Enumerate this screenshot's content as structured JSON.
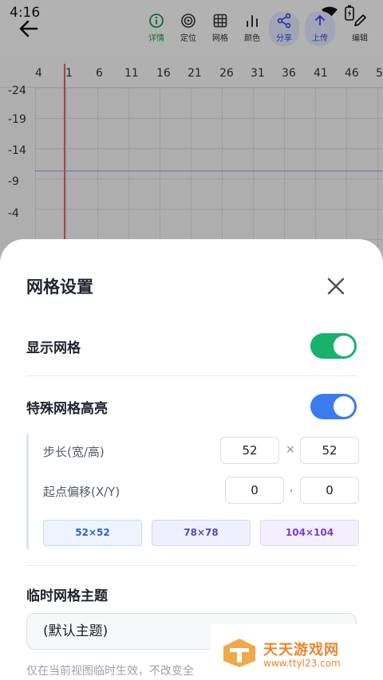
{
  "status_bar": {
    "time": "4:16"
  },
  "toolbar": {
    "items": [
      {
        "label": "详情",
        "icon": "info-icon"
      },
      {
        "label": "定位",
        "icon": "target-icon"
      },
      {
        "label": "网格",
        "icon": "grid-icon"
      },
      {
        "label": "颜色",
        "icon": "bar-chart-icon"
      },
      {
        "label": "分享",
        "icon": "share-icon"
      },
      {
        "label": "上传",
        "icon": "upload-icon"
      },
      {
        "label": "编辑",
        "icon": "pencil-icon"
      }
    ]
  },
  "ruler": {
    "x_ticks": [
      "4",
      "1",
      "6",
      "11",
      "16",
      "21",
      "26",
      "31",
      "36",
      "41",
      "46",
      "5"
    ],
    "y_ticks": [
      "-24",
      "-19",
      "-14",
      "-9",
      "-4"
    ]
  },
  "sheet": {
    "title": "网格设置",
    "show_grid": {
      "label": "显示网格",
      "on": true
    },
    "special_highlight": {
      "label": "特殊网格高亮",
      "on": true
    },
    "step": {
      "label": "步长(宽/高)",
      "width": "52",
      "height": "52",
      "separator": "×"
    },
    "offset": {
      "label": "起点偏移(X/Y)",
      "x": "0",
      "y": "0",
      "separator": ","
    },
    "presets": [
      "52×52",
      "78×78",
      "104×104"
    ],
    "theme": {
      "label": "临时网格主题",
      "value": "(默认主题)"
    },
    "hint": "仅在当前视图临时生效，不改变全"
  },
  "watermark": {
    "title": "天天游戏网",
    "url": "www.ttyl23.com"
  },
  "colors": {
    "toggle_green": "#18b26b",
    "toggle_blue": "#3b7bf0",
    "accent": "#2a48e0"
  }
}
